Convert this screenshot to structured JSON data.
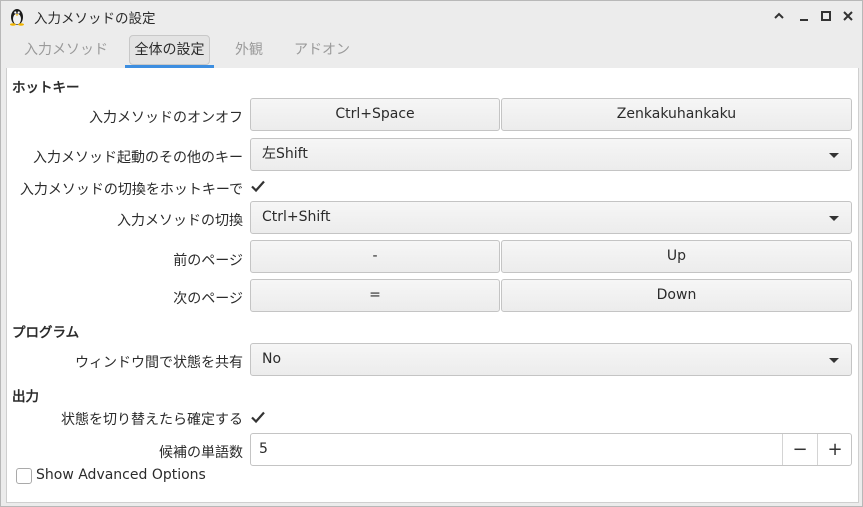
{
  "window": {
    "title": "入力メソッドの設定",
    "controls": [
      "minimize-icon",
      "restore-icon",
      "maximize-icon",
      "close-icon"
    ]
  },
  "tabs": [
    {
      "label": "入力メソッド",
      "active": false
    },
    {
      "label": "全体の設定",
      "active": true
    },
    {
      "label": "外観",
      "active": false
    },
    {
      "label": "アドオン",
      "active": false
    }
  ],
  "sections": {
    "hotkey": "ホットキー",
    "program": "プログラム",
    "output": "出力"
  },
  "rows": {
    "toggle_im": {
      "label": "入力メソッドのオンオフ",
      "key1": "Ctrl+Space",
      "key2": "Zenkakuhankaku"
    },
    "extra_trigger": {
      "label": "入力メソッド起動のその他のキー",
      "value": "左Shift"
    },
    "enable_hotkey_switch": {
      "label": "入力メソッドの切換をホットキーで",
      "checked": true
    },
    "switch_im": {
      "label": "入力メソッドの切換",
      "value": "Ctrl+Shift"
    },
    "prev_page": {
      "label": "前のページ",
      "key1": "-",
      "key2": "Up"
    },
    "next_page": {
      "label": "次のページ",
      "key1": "=",
      "key2": "Down"
    },
    "share_state": {
      "label": "ウィンドウ間で状態を共有",
      "value": "No"
    },
    "commit_on_switch": {
      "label": "状態を切り替えたら確定する",
      "checked": true
    },
    "candidate_words": {
      "label": "候補の単語数",
      "value": "5",
      "minus": "−",
      "plus": "+"
    }
  },
  "advanced": {
    "label": "Show Advanced Options",
    "checked": false
  },
  "colors": {
    "accent": "#3d8ee0"
  }
}
